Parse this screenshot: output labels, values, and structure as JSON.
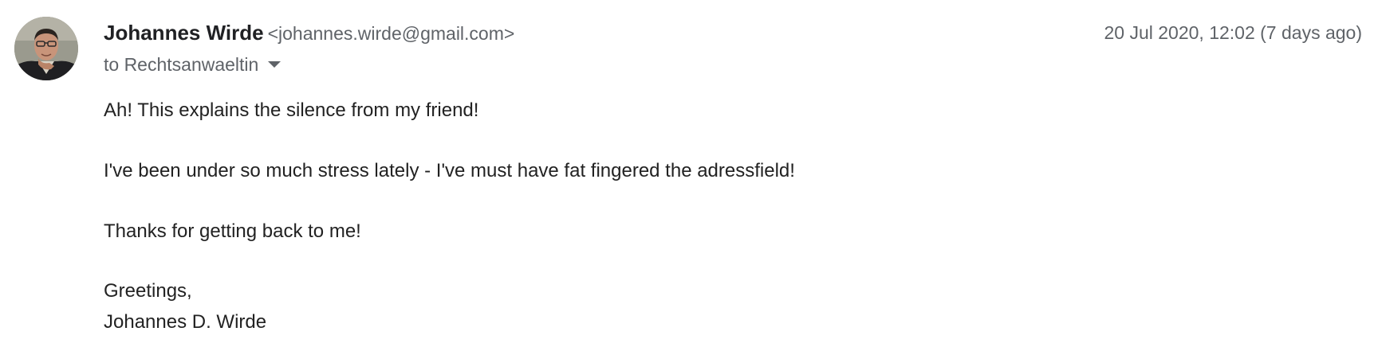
{
  "message": {
    "sender": {
      "name": "Johannes Wirde",
      "email": "<johannes.wirde@gmail.com>",
      "avatar_icon": "person-photo-avatar"
    },
    "date": "20 Jul 2020, 12:02 (7 days ago)",
    "recipients_label": "to Rechtsanwaeltin",
    "recipients_icon": "caret-down-icon",
    "body": {
      "line1": "Ah! This explains the silence from my friend!",
      "line2": "I've been under so much stress lately - I've must have fat fingered the adressfield!",
      "line3": "Thanks for getting back to me!",
      "line4": "Greetings,",
      "line5": "Johannes D. Wirde"
    }
  },
  "colors": {
    "primary_text": "#202124",
    "secondary_text": "#5f6368",
    "background": "#ffffff"
  }
}
